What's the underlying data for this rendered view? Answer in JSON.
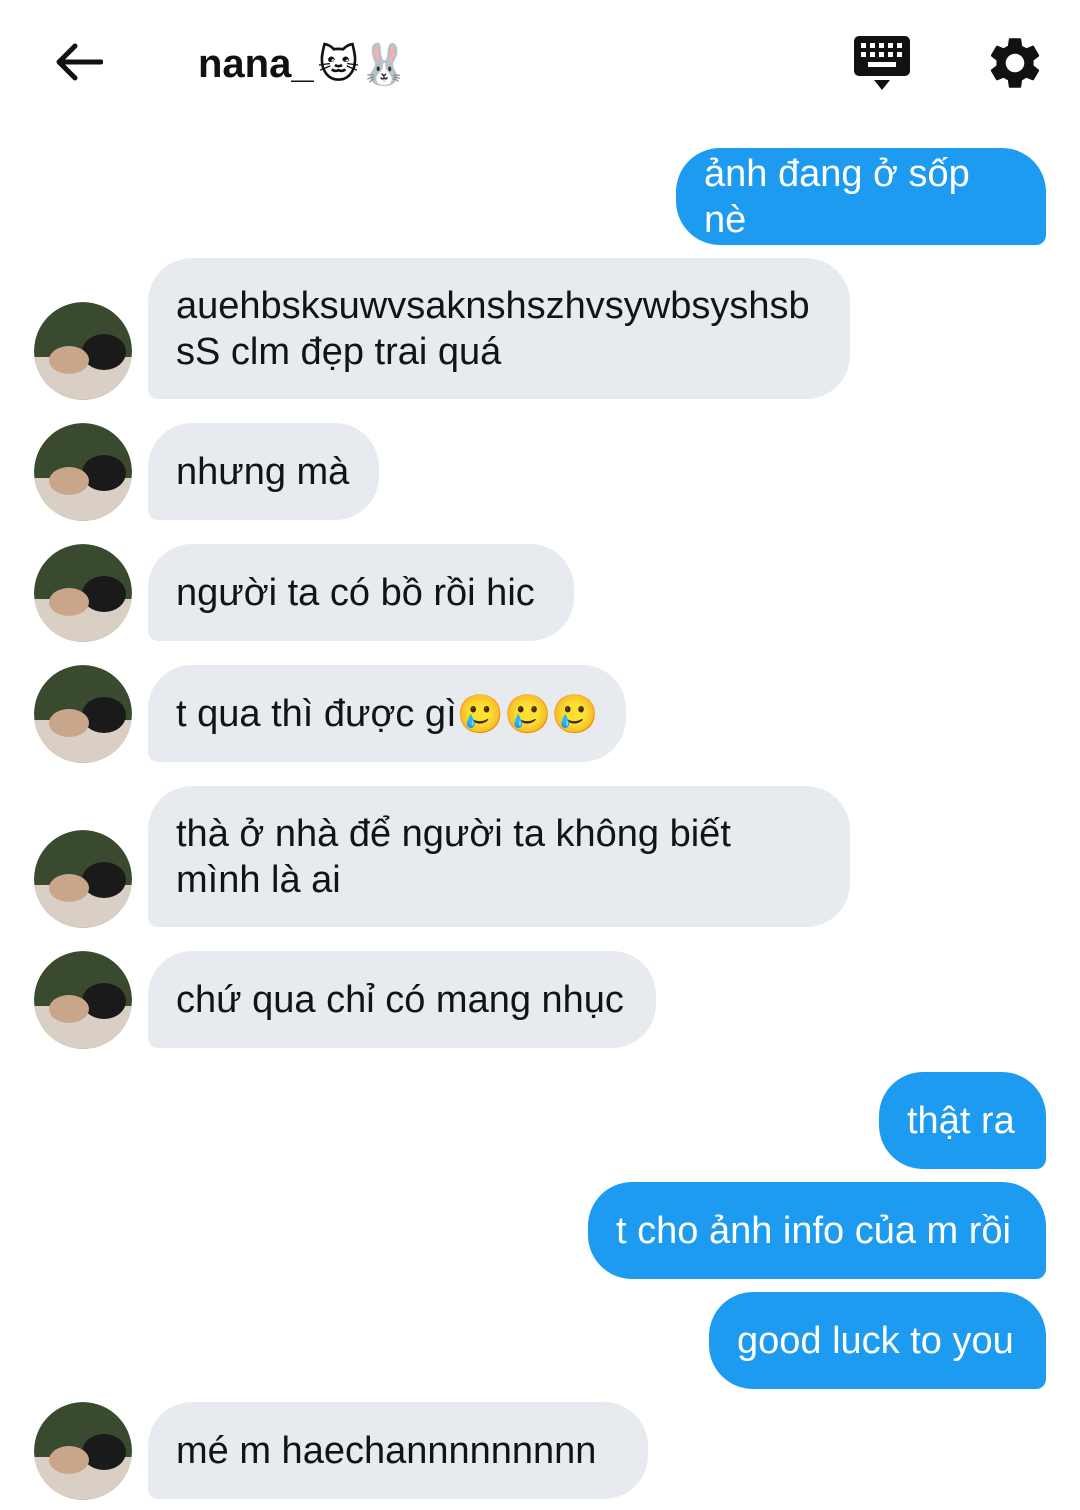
{
  "header": {
    "contact_name": "nana_",
    "name_emojis": "🐱🐰",
    "back_icon": "arrow-left-icon",
    "keyboard_icon": "keyboard-icon",
    "settings_icon": "gear-icon"
  },
  "colors": {
    "outgoing_bubble": "#1d9bf0",
    "incoming_bubble": "#e7eaee"
  },
  "messages": [
    {
      "direction": "out",
      "text": "ảnh đang ở sốp nè"
    },
    {
      "direction": "in",
      "text": "auehbsksuwvsaknshszhvsywbsyshsb sS clm đẹp trai quá"
    },
    {
      "direction": "in",
      "text": "nhưng mà"
    },
    {
      "direction": "in",
      "text": "người ta có bồ rồi hic"
    },
    {
      "direction": "in",
      "text": "t qua thì được gì",
      "emojis": "🥲🥲🥲"
    },
    {
      "direction": "in",
      "text": "thà ở nhà để người ta không biết mình là ai"
    },
    {
      "direction": "in",
      "text": "chứ qua chỉ có mang nhục"
    },
    {
      "direction": "out",
      "text": "thật ra"
    },
    {
      "direction": "out",
      "text": "t cho ảnh info của m rồi"
    },
    {
      "direction": "out",
      "text": "good luck to you"
    },
    {
      "direction": "in",
      "text": "mé m haechannnnnnnnn"
    }
  ]
}
